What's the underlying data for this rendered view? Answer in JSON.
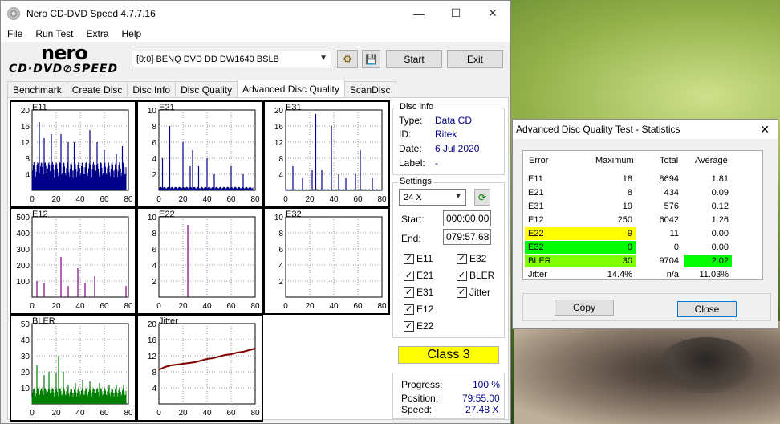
{
  "window": {
    "title": "Nero CD-DVD Speed 4.7.7.16",
    "minimize": "—",
    "maximize": "☐",
    "close": "✕"
  },
  "menu": [
    "File",
    "Run Test",
    "Extra",
    "Help"
  ],
  "logo": {
    "line1": "nero",
    "line2": "CD·DVD⊘SPEED"
  },
  "toolbar": {
    "drive": "[0:0]   BENQ DVD DD DW1640 BSLB",
    "start_label": "Start",
    "exit_label": "Exit"
  },
  "tabs": [
    "Benchmark",
    "Create Disc",
    "Disc Info",
    "Disc Quality",
    "Advanced Disc Quality",
    "ScanDisc"
  ],
  "disc_info": {
    "title": "Disc info",
    "rows": [
      {
        "k": "Type:",
        "v": "Data CD"
      },
      {
        "k": "ID:",
        "v": "Ritek"
      },
      {
        "k": "Date:",
        "v": "6 Jul 2020"
      },
      {
        "k": "Label:",
        "v": "-"
      }
    ]
  },
  "settings": {
    "title": "Settings",
    "speed": "24 X",
    "start_label": "Start:",
    "start_value": "000:00.00",
    "end_label": "End:",
    "end_value": "079:57.68",
    "checks": [
      "E11",
      "E32",
      "E21",
      "BLER",
      "E31",
      "Jitter",
      "E12",
      "E22"
    ]
  },
  "class_label": "Class 3",
  "progress": {
    "rows": [
      {
        "k": "Progress:",
        "v": "100 %"
      },
      {
        "k": "Position:",
        "v": "79:55.00"
      },
      {
        "k": "Speed:",
        "v": "27.48 X"
      }
    ]
  },
  "stats": {
    "title": "Advanced Disc Quality Test - Statistics",
    "headers": [
      "Error",
      "Maximum",
      "Total",
      "Average"
    ],
    "rows": [
      {
        "err": "E11",
        "max": "18",
        "total": "8694",
        "avg": "1.81"
      },
      {
        "err": "E21",
        "max": "8",
        "total": "434",
        "avg": "0.09"
      },
      {
        "err": "E31",
        "max": "19",
        "total": "576",
        "avg": "0.12"
      },
      {
        "err": "E12",
        "max": "250",
        "total": "6042",
        "avg": "1.26"
      },
      {
        "err": "E22",
        "max": "9",
        "total": "11",
        "avg": "0.00"
      },
      {
        "err": "E32",
        "max": "0",
        "total": "0",
        "avg": "0.00"
      },
      {
        "err": "BLER",
        "max": "30",
        "total": "9704",
        "avg": "2.02"
      },
      {
        "err": "Jitter",
        "max": "14.4%",
        "total": "n/a",
        "avg": "11.03%"
      }
    ],
    "copy_label": "Copy",
    "close_label": "Close",
    "highlight_colors": {
      "yellow": "#ffff00",
      "green": "#00ff00",
      "lime": "#80ff00"
    }
  },
  "chart_data": [
    {
      "type": "bar",
      "title": "E11",
      "yticks": [
        "20",
        "16",
        "12",
        "8",
        "4"
      ],
      "xticks": [
        "0",
        "20",
        "40",
        "60",
        "80"
      ],
      "ylim": [
        0,
        20
      ],
      "xlim": [
        0,
        80
      ],
      "color": "#00008b",
      "baseline": 5,
      "spikes": [
        [
          6,
          17
        ],
        [
          10,
          13
        ],
        [
          16,
          14
        ],
        [
          24,
          14
        ],
        [
          30,
          12
        ],
        [
          35,
          12
        ],
        [
          48,
          15
        ],
        [
          54,
          12
        ],
        [
          60,
          10
        ],
        [
          70,
          9
        ],
        [
          75,
          11
        ]
      ]
    },
    {
      "type": "bar",
      "title": "E21",
      "yticks": [
        "10",
        "8",
        "6",
        "4",
        "2"
      ],
      "xticks": [
        "0",
        "20",
        "40",
        "60",
        "80"
      ],
      "ylim": [
        0,
        10
      ],
      "xlim": [
        0,
        80
      ],
      "color": "#00008b",
      "baseline": 0.3,
      "spikes": [
        [
          3,
          4
        ],
        [
          9,
          8
        ],
        [
          20,
          6
        ],
        [
          26,
          3
        ],
        [
          28,
          5
        ],
        [
          33,
          3
        ],
        [
          40,
          4
        ],
        [
          46,
          2
        ],
        [
          60,
          3
        ],
        [
          70,
          2
        ]
      ]
    },
    {
      "type": "bar",
      "title": "E31",
      "yticks": [
        "20",
        "16",
        "12",
        "8",
        "4"
      ],
      "xticks": [
        "0",
        "20",
        "40",
        "60",
        "80"
      ],
      "ylim": [
        0,
        20
      ],
      "xlim": [
        0,
        80
      ],
      "color": "#00008b",
      "baseline": 0.2,
      "spikes": [
        [
          6,
          6
        ],
        [
          14,
          3
        ],
        [
          22,
          5
        ],
        [
          25,
          19
        ],
        [
          30,
          5
        ],
        [
          38,
          16
        ],
        [
          44,
          4
        ],
        [
          50,
          3
        ],
        [
          58,
          4
        ],
        [
          62,
          10
        ],
        [
          72,
          3
        ]
      ]
    },
    {
      "type": "bar",
      "title": "E12",
      "yticks": [
        "500",
        "400",
        "300",
        "200",
        "100"
      ],
      "xticks": [
        "0",
        "20",
        "40",
        "60",
        "80"
      ],
      "ylim": [
        0,
        500
      ],
      "xlim": [
        0,
        80
      ],
      "color": "#800080",
      "baseline": 0,
      "spikes": [
        [
          4,
          100
        ],
        [
          10,
          90
        ],
        [
          24,
          250
        ],
        [
          30,
          70
        ],
        [
          38,
          180
        ],
        [
          44,
          90
        ],
        [
          52,
          130
        ],
        [
          78,
          70
        ]
      ]
    },
    {
      "type": "bar",
      "title": "E22",
      "yticks": [
        "10",
        "8",
        "6",
        "4",
        "2"
      ],
      "xticks": [
        "0",
        "20",
        "40",
        "60",
        "80"
      ],
      "ylim": [
        0,
        10
      ],
      "xlim": [
        0,
        80
      ],
      "color": "#800080",
      "baseline": 0,
      "spikes": [
        [
          24,
          9
        ]
      ]
    },
    {
      "type": "bar",
      "title": "E32",
      "yticks": [
        "10",
        "8",
        "6",
        "4",
        "2"
      ],
      "xticks": [
        "0",
        "20",
        "40",
        "60",
        "80"
      ],
      "ylim": [
        0,
        10
      ],
      "xlim": [
        0,
        80
      ],
      "color": "#800080",
      "baseline": 0,
      "spikes": []
    },
    {
      "type": "bar",
      "title": "BLER",
      "yticks": [
        "50",
        "40",
        "30",
        "20",
        "10"
      ],
      "xticks": [
        "0",
        "20",
        "40",
        "60",
        "80"
      ],
      "ylim": [
        0,
        50
      ],
      "xlim": [
        0,
        80
      ],
      "color": "#008000",
      "baseline": 7,
      "spikes": [
        [
          4,
          24
        ],
        [
          10,
          18
        ],
        [
          14,
          20
        ],
        [
          20,
          19
        ],
        [
          22,
          30
        ],
        [
          26,
          20
        ],
        [
          30,
          12
        ],
        [
          36,
          13
        ],
        [
          42,
          15
        ],
        [
          48,
          14
        ],
        [
          56,
          13
        ],
        [
          64,
          12
        ],
        [
          70,
          12
        ],
        [
          76,
          12
        ]
      ]
    },
    {
      "type": "line",
      "title": "Jitter",
      "yticks": [
        "20",
        "16",
        "12",
        "8",
        "4"
      ],
      "xticks": [
        "0",
        "20",
        "40",
        "60",
        "80"
      ],
      "ylim": [
        0,
        20
      ],
      "xlim": [
        0,
        80
      ],
      "color": "#800000",
      "points": [
        [
          0,
          8.5
        ],
        [
          5,
          9.2
        ],
        [
          10,
          9.6
        ],
        [
          15,
          9.8
        ],
        [
          20,
          10.0
        ],
        [
          25,
          10.2
        ],
        [
          30,
          10.4
        ],
        [
          35,
          10.8
        ],
        [
          40,
          11.2
        ],
        [
          45,
          11.4
        ],
        [
          50,
          11.8
        ],
        [
          55,
          12.2
        ],
        [
          60,
          12.4
        ],
        [
          65,
          12.8
        ],
        [
          70,
          13.0
        ],
        [
          75,
          13.4
        ],
        [
          80,
          13.8
        ]
      ]
    }
  ]
}
